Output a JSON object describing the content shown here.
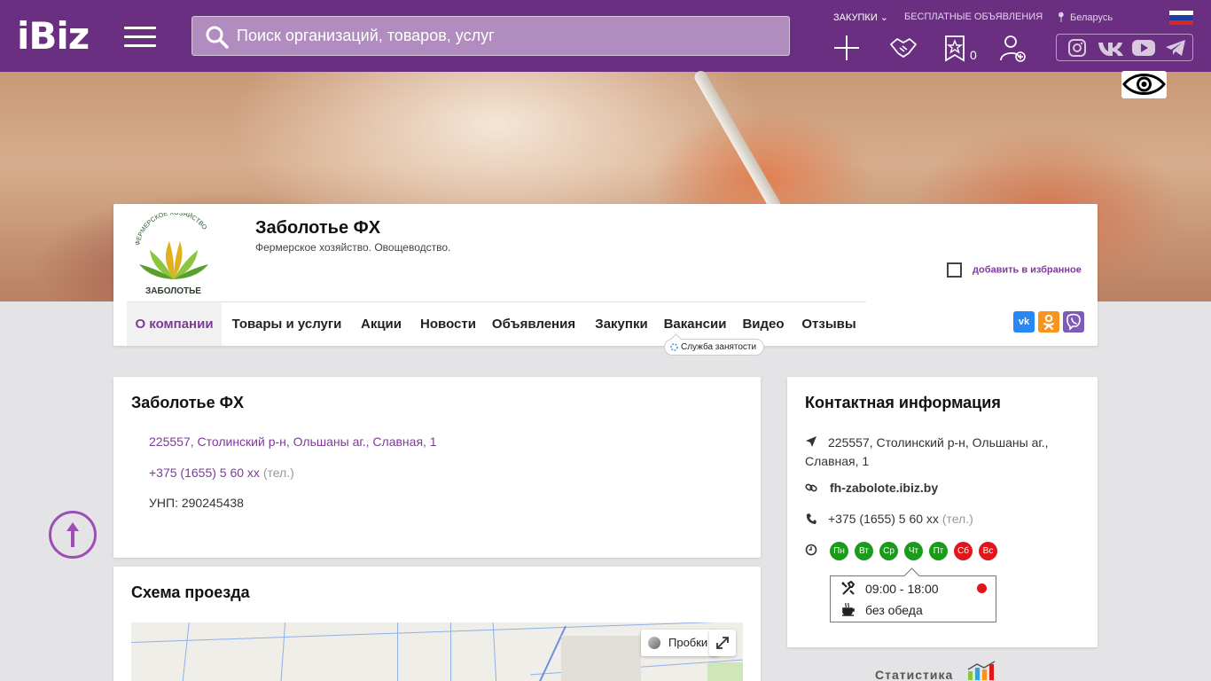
{
  "header": {
    "logo": "iBiz",
    "search_placeholder": "Поиск организаций, товаров, услуг",
    "nav_purchases": "ЗАКУПКИ",
    "nav_free_ads": "БЕСПЛАТНЫЕ ОБЪЯВЛЕНИЯ",
    "region": "Беларусь",
    "favorites_count": "0",
    "social_icons": [
      "instagram-icon",
      "vk-icon",
      "youtube-icon",
      "telegram-icon"
    ]
  },
  "company": {
    "logo_text": "ЗАБОЛОТЬЕ",
    "logo_arc_text": "ФЕРМЕРСКОЕ ХОЗЯЙСТВО",
    "name": "Заболотье ФХ",
    "description": "Фермерское хозяйство. Овощеводство.",
    "favorite_label": "добавить в избранное",
    "tabs": [
      {
        "label": "О компании",
        "active": true
      },
      {
        "label": "Товары и услуги"
      },
      {
        "label": "Акции"
      },
      {
        "label": "Новости"
      },
      {
        "label": "Объявления"
      },
      {
        "label": "Закупки"
      },
      {
        "label": "Вакансии"
      },
      {
        "label": "Видео"
      },
      {
        "label": "Отзывы"
      }
    ],
    "vacancy_tooltip": "Служба занятости",
    "share": [
      "vk",
      "ok",
      "viber"
    ]
  },
  "about": {
    "title": "Заболотье ФХ",
    "address": "225557, Столинский р-н, Ольшаны аг., Славная, 1",
    "phone": "+375 (1655) 5 60 xx",
    "phone_type": "(тел.)",
    "unp": "УНП: 290245438"
  },
  "map_panel": {
    "title": "Схема проезда",
    "traffic_label": "Пробки"
  },
  "contacts": {
    "title": "Контактная информация",
    "address_line1": "225557, Столинский р-н, Ольшаны аг.,",
    "address_line2": "Славная, 1",
    "website": "fh-zabolote.ibiz.by",
    "phone": "+375 (1655) 5 60 xx",
    "phone_type": "(тел.)",
    "days": [
      {
        "label": "Пн",
        "open": true
      },
      {
        "label": "Вт",
        "open": true
      },
      {
        "label": "Ср",
        "open": true
      },
      {
        "label": "Чт",
        "open": true
      },
      {
        "label": "Пт",
        "open": true
      },
      {
        "label": "Сб",
        "open": false
      },
      {
        "label": "Вс",
        "open": false
      }
    ],
    "hours": "09:00 - 18:00",
    "lunch": "без обеда"
  },
  "stats_label": "Статистика",
  "colors": {
    "brand": "#6b2f82",
    "accent": "#7d3b98",
    "open_day": "#1a9b1a",
    "closed_day": "#e0161b"
  }
}
